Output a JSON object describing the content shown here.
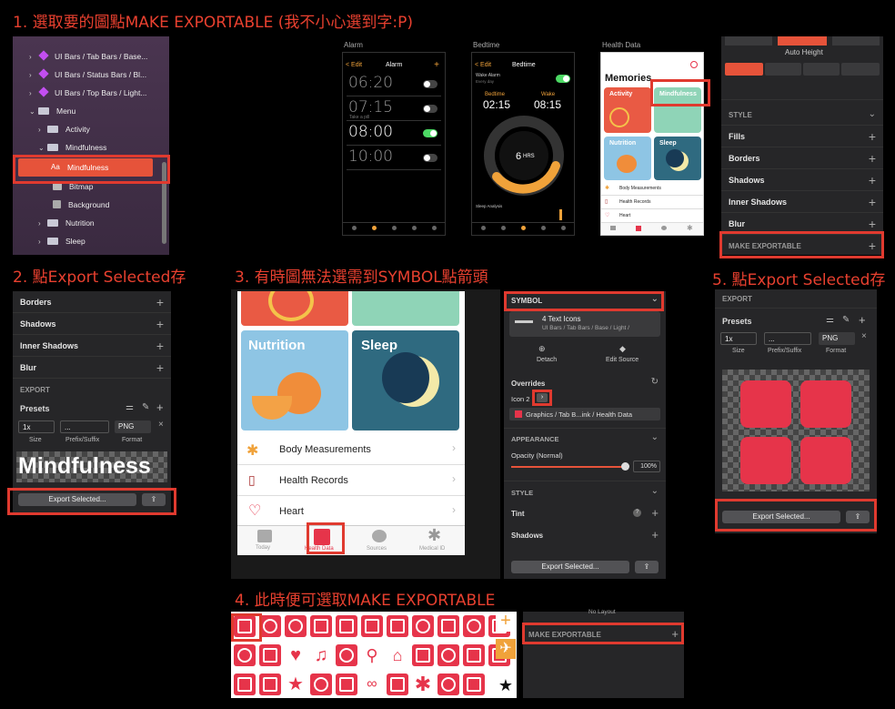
{
  "captions": {
    "step1": "1. 選取要的圖點MAKE EXPORTABLE (我不小心選到字:P)",
    "step2": "2. 點Export Selected存",
    "step3": "3. 有時圖無法選需到SYMBOL點箭頭",
    "step4": "4. 此時便可選取MAKE EXPORTABLE",
    "step5": "5. 點Export Selected存"
  },
  "layers": [
    {
      "label": "UI Bars / Tab Bars / Base..."
    },
    {
      "label": "UI Bars / Status Bars / Bl..."
    },
    {
      "label": "UI Bars / Top Bars / Light..."
    },
    {
      "label": "Menu"
    },
    {
      "label": "Activity"
    },
    {
      "label": "Mindfulness"
    },
    {
      "label": "Mindfulness"
    },
    {
      "label": "Bitmap"
    },
    {
      "label": "Background"
    },
    {
      "label": "Nutrition"
    },
    {
      "label": "Sleep"
    }
  ],
  "layer_prefix": "Aa",
  "artboards": {
    "alarm": "Alarm",
    "bedtime": "Bedtime",
    "health": "Health Data"
  },
  "alarm": {
    "edit": "< Edit",
    "title": "Alarm",
    "plus": "+",
    "times": [
      "06:20",
      "07:15",
      "08:00",
      "10:00"
    ],
    "subs": [
      "Alarm",
      "Take a pill",
      "Alarm",
      "Alarm"
    ]
  },
  "bedtime": {
    "edit": "< Edit",
    "title": "Bedtime",
    "wake_alarm": "Wake Alarm",
    "every_day": "Every day",
    "bed_label": "Bedtime",
    "wake_label": "Wake",
    "bed_time": "02:15",
    "wake_time": "08:15",
    "hrs": "6",
    "hrs_unit": "HRS",
    "analysis": "Sleep Analysis"
  },
  "health_small": {
    "title": "Memories",
    "tiles": [
      "Activity",
      "Mindfulness",
      "Nutrition",
      "Sleep"
    ],
    "rows": [
      "Body Measurements",
      "Health Records",
      "Heart"
    ]
  },
  "right_panel": {
    "auto_height": "Auto Height",
    "style": "STYLE",
    "fills": "Fills",
    "borders": "Borders",
    "shadows": "Shadows",
    "inner_shadows": "Inner Shadows",
    "blur": "Blur",
    "make_exportable": "MAKE EXPORTABLE",
    "plus": "+"
  },
  "export_panel": {
    "borders": "Borders",
    "shadows": "Shadows",
    "inner_shadows": "Inner Shadows",
    "blur": "Blur",
    "export": "EXPORT",
    "presets": "Presets",
    "size": "1x",
    "prefix": "...",
    "format": "PNG",
    "size_label": "Size",
    "prefix_label": "Prefix/Suffix",
    "format_label": "Format",
    "preview_text": "Mindfulness",
    "export_button": "Export Selected...",
    "close": "×"
  },
  "health_large": {
    "tiles": [
      "Nutrition",
      "Sleep"
    ],
    "rows": [
      "Body Measurements",
      "Health Records",
      "Heart"
    ],
    "tabs": [
      "Today",
      "Health Data",
      "Sources",
      "Medical ID"
    ]
  },
  "symbol_panel": {
    "symbol": "SYMBOL",
    "symbol_name": "4 Text Icons",
    "symbol_path": "UI Bars / Tab Bars / Base / Light /",
    "detach": "Detach",
    "edit_source": "Edit Source",
    "overrides": "Overrides",
    "icon": "Icon 2",
    "override_value": "Graphics / Tab B...ink / Health Data",
    "appearance": "APPEARANCE",
    "opacity": "Opacity (Normal)",
    "opacity_value": "100%",
    "style": "STYLE",
    "tint": "Tint",
    "shadows": "Shadows",
    "export_button": "Export Selected..."
  },
  "icons_panel": {
    "no_layout": "No Layout",
    "make_exportable": "MAKE EXPORTABLE",
    "plus": "+"
  },
  "final_export": {
    "export": "EXPORT",
    "presets": "Presets",
    "size": "1x",
    "prefix": "...",
    "format": "PNG",
    "size_label": "Size",
    "prefix_label": "Prefix/Suffix",
    "format_label": "Format",
    "export_button": "Export Selected...",
    "close": "×"
  },
  "colors": {
    "accent_red": "#e03a2f",
    "icon_red": "#e6344a",
    "purple_bg": "#3a2a3f",
    "panel": "#262628"
  }
}
